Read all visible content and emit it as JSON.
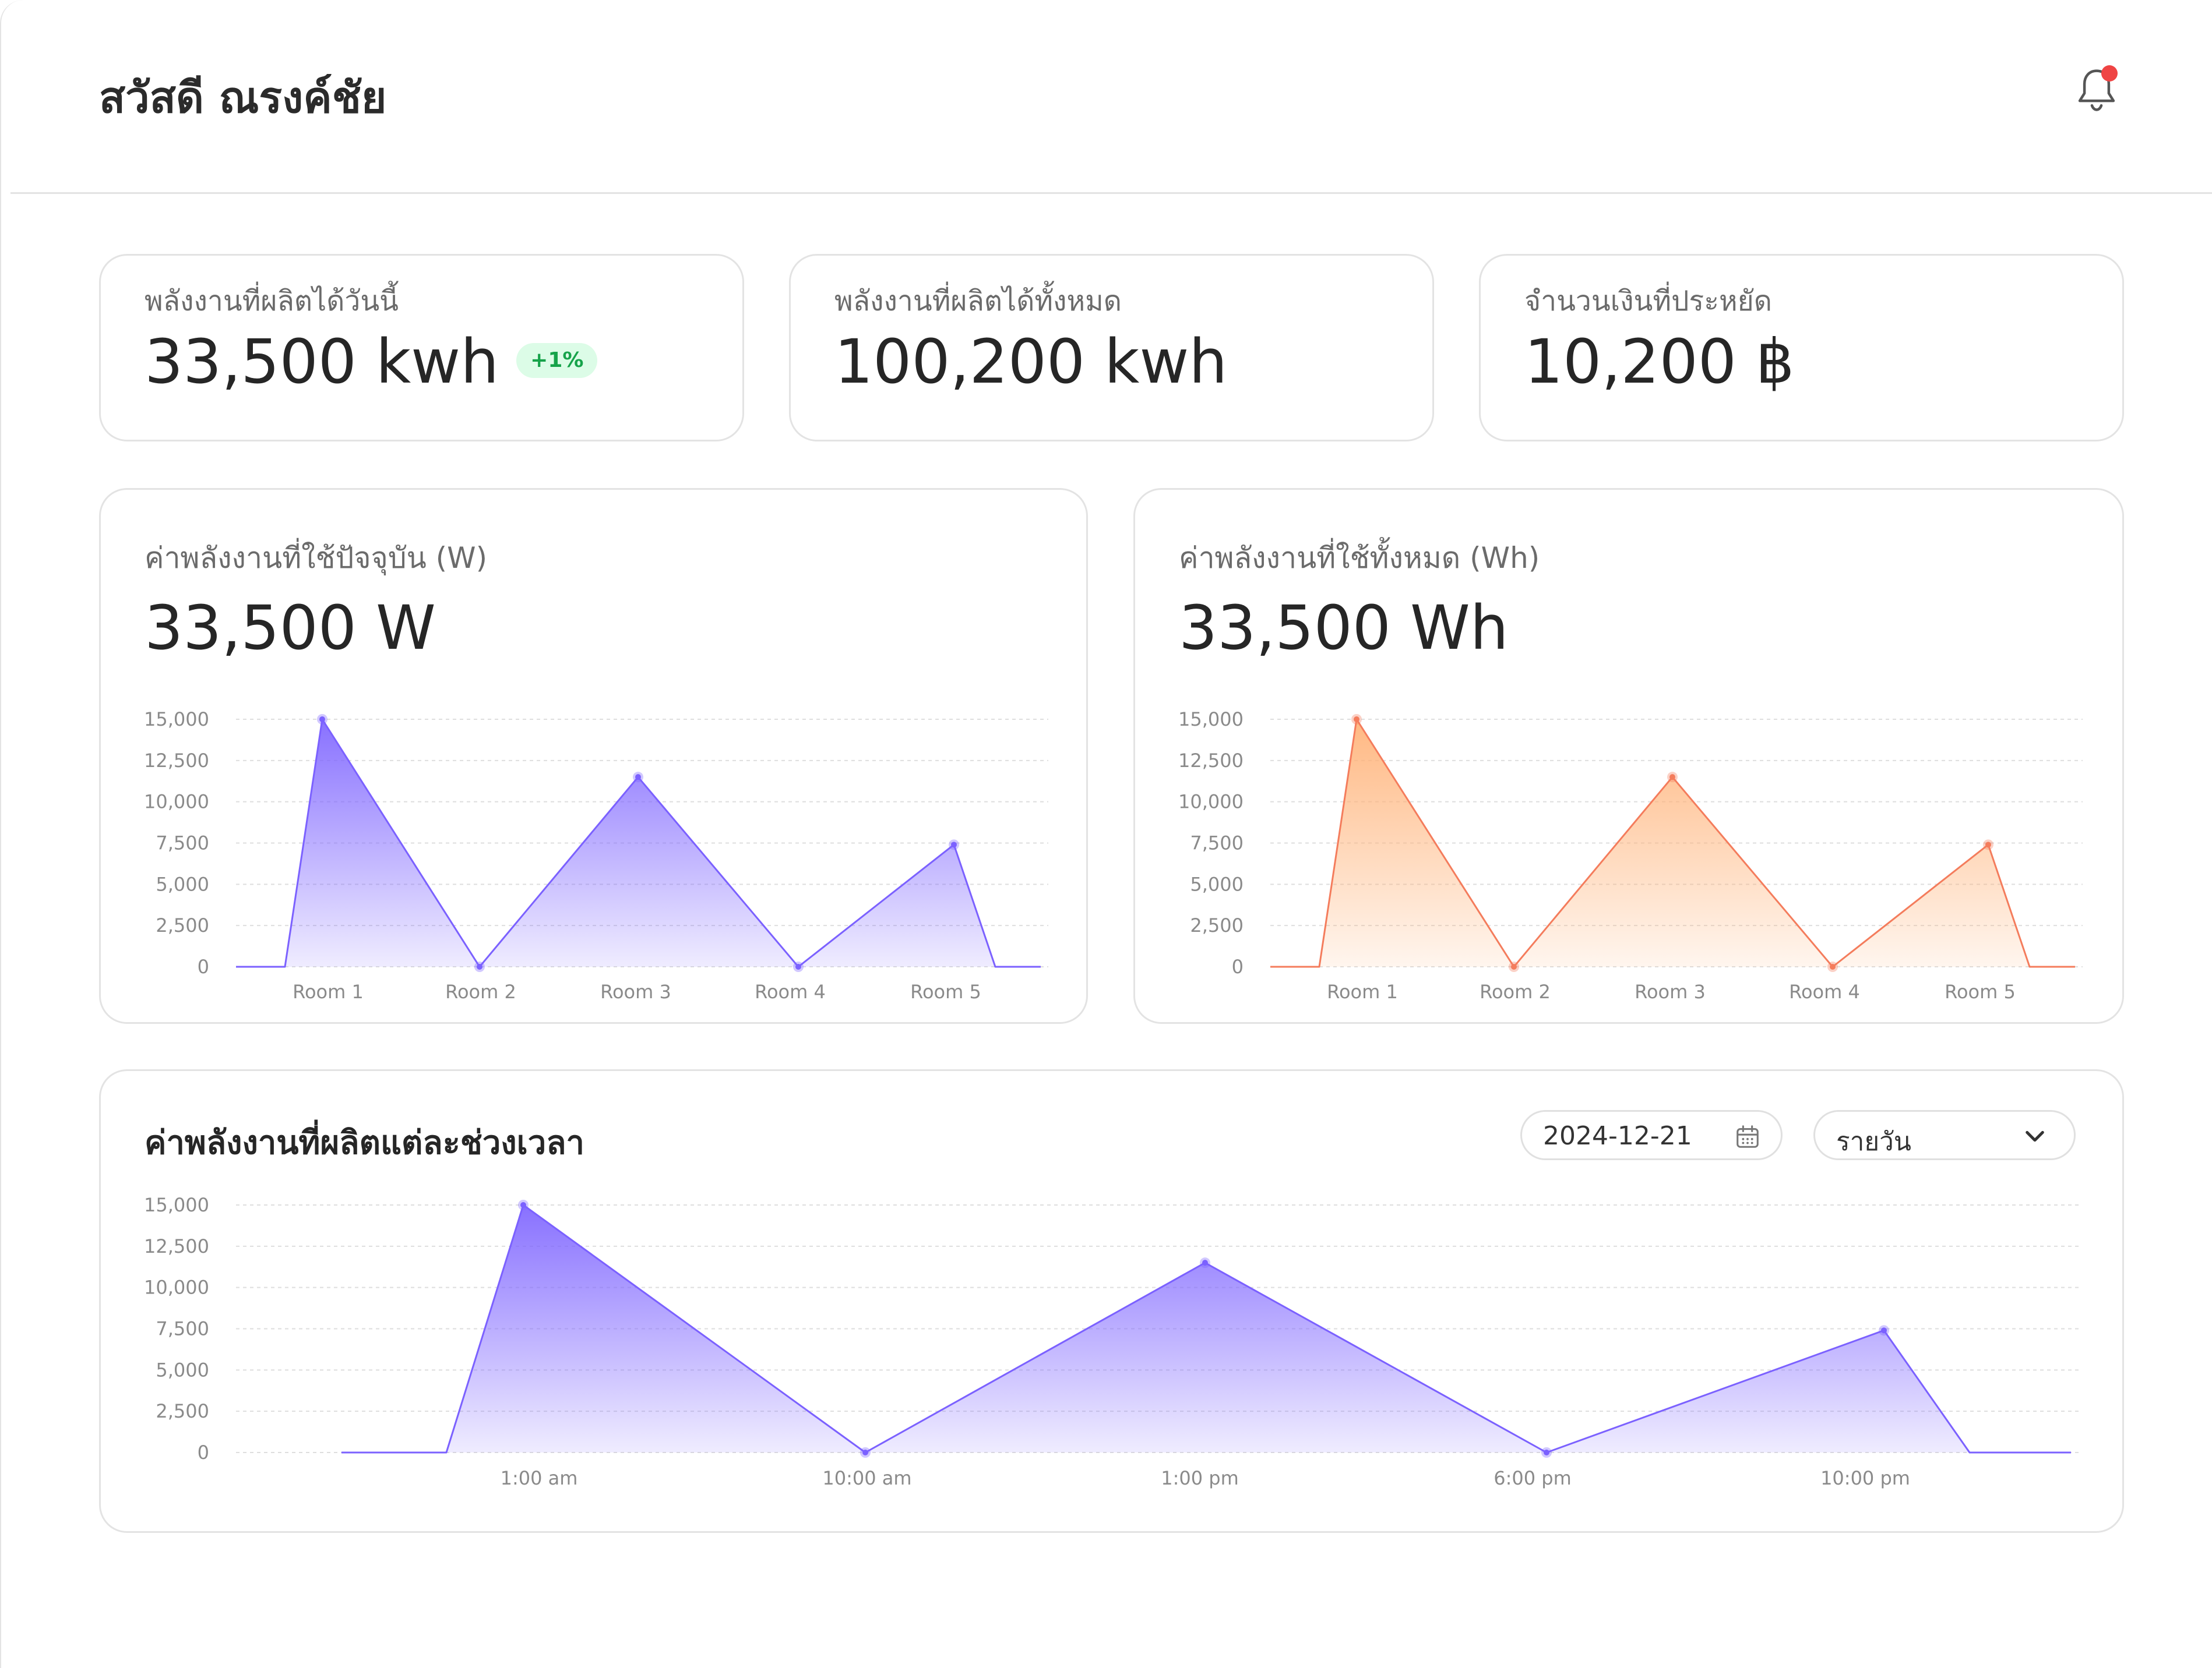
{
  "header": {
    "greeting": "สวัสดี ณรงค์ชัย",
    "notification_icon": "bell-icon",
    "has_notification": true
  },
  "stats": [
    {
      "label": "พลังงานที่ผลิตได้วันนี้",
      "value": "33,500 kwh",
      "badge": "+1%"
    },
    {
      "label": "พลังงานที่ผลิตได้ทั้งหมด",
      "value": "100,200 kwh"
    },
    {
      "label": "จำนวนเงินที่ประหยัด",
      "value": "10,200 ฿"
    }
  ],
  "current_usage": {
    "label": "ค่าพลังงานที่ใช้ปัจจุบัน (W)",
    "value": "33,500 W"
  },
  "total_usage": {
    "label": "ค่าพลังงานที่ใช้ทั้งหมด (Wh)",
    "value": "33,500 Wh"
  },
  "production": {
    "title": "ค่าพลังงานที่ผลิตแต่ละช่วงเวลา",
    "date_value": "2024-12-21",
    "date_icon": "calendar-icon",
    "period_value": "รายวัน",
    "period_icon": "chevron-down-icon"
  },
  "colors": {
    "purple": "#7b61ff",
    "orange": "#f47c5c",
    "orange_fill": "#ffb074",
    "positive_badge": "#16a34a"
  },
  "chart_data": [
    {
      "type": "area",
      "categories": [
        "Room 1",
        "Room 2",
        "Room 3",
        "Room 4",
        "Room 5"
      ],
      "values": [
        15000,
        0,
        11500,
        0,
        7400
      ],
      "ylim": [
        0,
        15000
      ],
      "yticks": [
        "0",
        "2,500",
        "5,000",
        "7,500",
        "10,000",
        "12,500",
        "15,000"
      ],
      "grid": true
    },
    {
      "type": "area",
      "categories": [
        "Room 1",
        "Room 2",
        "Room 3",
        "Room 4",
        "Room 5"
      ],
      "values": [
        15000,
        0,
        11500,
        0,
        7400
      ],
      "ylim": [
        0,
        15000
      ],
      "yticks": [
        "0",
        "2,500",
        "5,000",
        "7,500",
        "10,000",
        "12,500",
        "15,000"
      ],
      "grid": true
    },
    {
      "type": "area",
      "categories": [
        "1:00 am",
        "10:00 am",
        "1:00 pm",
        "6:00 pm",
        "10:00 pm"
      ],
      "values": [
        15000,
        0,
        11500,
        0,
        7400
      ],
      "ylim": [
        0,
        15000
      ],
      "yticks": [
        "0",
        "2,500",
        "5,000",
        "7,500",
        "10,000",
        "12,500",
        "15,000"
      ],
      "grid": true
    }
  ]
}
